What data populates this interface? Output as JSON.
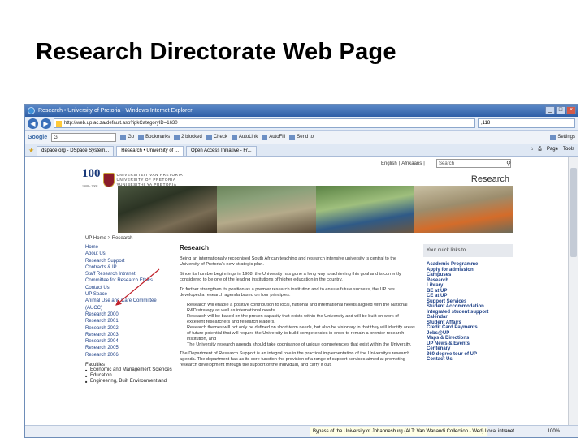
{
  "slide": {
    "title": "Research Directorate Web Page"
  },
  "browser": {
    "window_title": "Research • University of Pretoria - Windows Internet Explorer",
    "address": "http://web.up.ac.za/default.asp?ipkCategoryID=1630",
    "search_box": ",118",
    "google_label": "Google",
    "toolbar_items": [
      "Go",
      "Bookmarks",
      "2 blocked",
      "Check",
      "AutoLink",
      "AutoFill",
      "Send to",
      "Settings"
    ],
    "tabs": [
      {
        "label": "dspace.org - DSpace System..."
      },
      {
        "label": "Research • University of ..."
      },
      {
        "label": "Open Access Initiative - Fr..."
      }
    ],
    "tab_right": [
      "Page",
      "Tools"
    ],
    "status_zone": "Local intranet",
    "zoom": "100%",
    "status_tip": "Bypass of the University of Johannesburg (ALT: Van Wanandi Collection - Wed)"
  },
  "page": {
    "logo_100": "100",
    "logo_years": "1908 - 2008",
    "university_name": [
      "UNIVERSITEIT VAN PRETORIA",
      "UNIVERSITY OF PRETORIA",
      "YUNIBESITHI YA PRETORIA"
    ],
    "languages": [
      "English",
      "Afrikaans"
    ],
    "search_placeholder": "Search",
    "brand_title": "Research",
    "breadcrumb": "UP Home > Research",
    "nav": [
      "Home",
      "About Us",
      "Research Support",
      "Contracts & IP",
      "Staff Research Intranet",
      "Committee for Research Ethics",
      "Contact Us",
      "UP Space",
      "Animal Use and Care Committee (AUCC)",
      "Research 2000",
      "Research 2001",
      "Research 2002",
      "Research 2003",
      "Research 2004",
      "Research 2005",
      "Research 2006"
    ],
    "faculties_title": "Faculties",
    "faculties": [
      "Economic and Management Sciences",
      "Education",
      "Engineering, Built Environment and"
    ],
    "main_title": "Research",
    "paragraphs": [
      "Being an internationally recognised South African teaching and research intensive university is central to the University of Pretoria's new strategic plan.",
      "Since its humble beginnings in 1908, the University has gone a long way to achieving this goal and is currently considered to be one of the leading institutions of higher education in the country.",
      "To further strengthen its position as a premier research institution and to ensure future success, the UP has developed a research agenda based on four principles:"
    ],
    "bullets": [
      "Research will enable a positive contribution to local, national and international needs aligned with the National R&D strategy as well as international needs.",
      "Research will be based on the proven capacity that exists within the University and will be built on work of excellent researchers and research leaders.",
      "Research themes will not only be defined on short-term needs, but also be visionary in that they will identify areas of future potential that will require the University to build competencies in order to remain a premier research institution, and",
      "The University research agenda should take cognisance of unique competencies that exist within the University."
    ],
    "closing": "The Department of Research Support is an integral role in the practical implementation of the University's research agenda. The department has as its core function the provision of a range of support services aimed at promoting research development through the support of the individual, and carry it out.",
    "quick_links_head": "Your quick links to ...",
    "quick_links": [
      "Academic Programme",
      "Apply for admission",
      "Campuses",
      "Research",
      "Library",
      "BE at UP",
      "CE at UP",
      "Support Services",
      "Student Accommodation",
      "Integrated student support",
      "Calendar",
      "Student Affairs",
      "Credit Card Payments",
      "Jobs@UP",
      "Maps & Directions",
      "UP News & Events",
      "Centenary",
      "360 degree tour of UP",
      "Contact Us"
    ]
  },
  "colors": {
    "link": "#1c3f86",
    "arrow": "#c0202a",
    "titlebar": "#2d5ea6"
  }
}
